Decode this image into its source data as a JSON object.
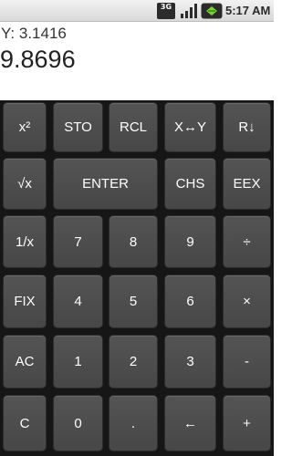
{
  "status_bar": {
    "network_label": "3G",
    "time": "5:17 AM",
    "icons": [
      "3g-icon",
      "signal-icon",
      "battery-icon"
    ]
  },
  "display": {
    "y_label": "Y:",
    "y_value": "3.1416",
    "x_value": "9.8696"
  },
  "keypad": {
    "rows": [
      [
        "x²",
        "STO",
        "RCL",
        "X↔Y",
        "R↓"
      ],
      [
        "√x",
        "ENTER",
        "CHS",
        "EEX"
      ],
      [
        "1/x",
        "7",
        "8",
        "9",
        "÷"
      ],
      [
        "FIX",
        "4",
        "5",
        "6",
        "×"
      ],
      [
        "AC",
        "1",
        "2",
        "3",
        "-"
      ],
      [
        "C",
        "0",
        ".",
        "←",
        "+"
      ]
    ]
  },
  "colors": {
    "keypad_background": "#161616",
    "key_face": "#4d4d4d",
    "key_text": "#ffffff",
    "status_bar": "#e0e0e0"
  }
}
